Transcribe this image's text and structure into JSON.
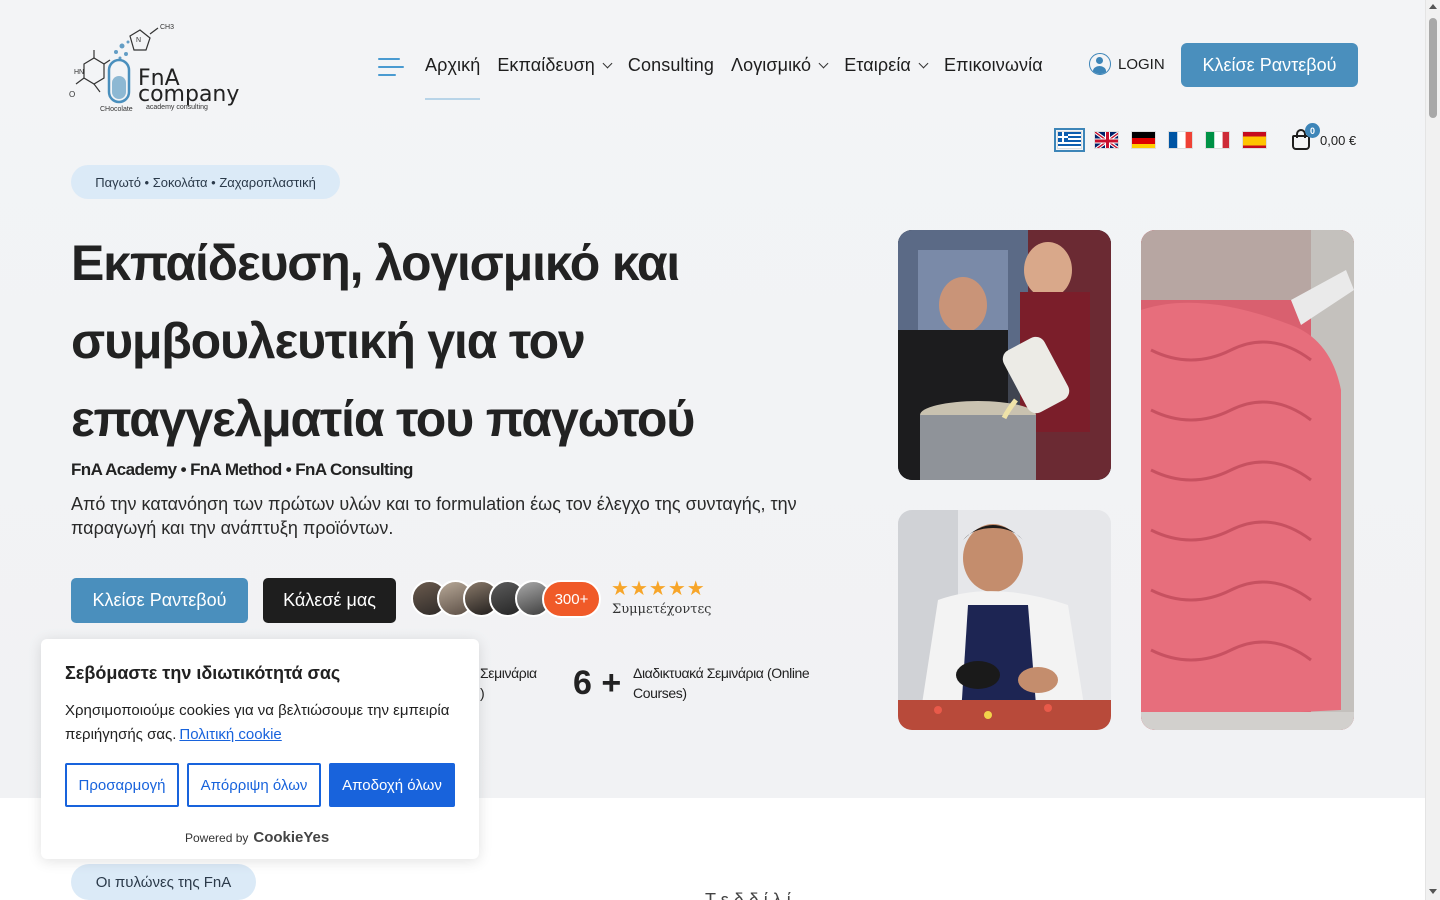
{
  "header": {
    "logo": {
      "brand": "FnA",
      "company": "company",
      "tagline": "academy consulting",
      "chem_labels": [
        "CH3",
        "HN",
        "O",
        "N",
        "CHocolate"
      ]
    },
    "nav": [
      {
        "label": "Αρχική",
        "dropdown": false,
        "active": true
      },
      {
        "label": "Εκπαίδευση",
        "dropdown": true,
        "active": false
      },
      {
        "label": "Consulting",
        "dropdown": false,
        "active": false
      },
      {
        "label": "Λογισμικό",
        "dropdown": true,
        "active": false
      },
      {
        "label": "Εταιρεία",
        "dropdown": true,
        "active": false
      },
      {
        "label": "Επικοινωνία",
        "dropdown": false,
        "active": false
      }
    ],
    "login_label": "LOGIN",
    "cta_label": "Κλείσε Ραντεβού",
    "languages": [
      "greek",
      "english",
      "german",
      "french",
      "italian",
      "spanish"
    ],
    "selected_language": "greek",
    "cart": {
      "count": "0",
      "total": "0,00 €"
    }
  },
  "hero": {
    "tag": "Παγωτό • Σοκολάτα • Ζαχαροπλαστική",
    "title_lines": [
      "Εκπαίδευση, λογισμικό και",
      "συμβουλευτική για τον",
      "επαγγελματία του παγωτού"
    ],
    "subtitle": "FnA Academy • FnA Method • FnA Consulting",
    "description": "Από την κατανόηση των πρώτων υλών και το formulation έως τον έλεγχο της συνταγής, την παραγωγή και την ανάπτυξη προϊόντων.",
    "primary_button": "Κλείσε Ραντεβού",
    "secondary_button": "Κάλεσέ μας",
    "participants": {
      "count": "300+",
      "rating": 5,
      "label": "Συμμετέχοντες"
    },
    "stats": [
      {
        "partial_label": "Σεμινάρια",
        "partial_suffix": ")"
      },
      {
        "number": "6 +",
        "label": "Διαδικτυακά Σεμινάρια (Online Courses)"
      }
    ]
  },
  "cookie_banner": {
    "title": "Σεβόμαστε την ιδιωτικότητά σας",
    "text": "Χρησιμοποιούμε cookies για να βελτιώσουμε την εμπειρία περιήγησής σας.",
    "link": "Πολιτική cookie",
    "buttons": {
      "customize": "Προσαρμογή",
      "reject": "Απόρριψη όλων",
      "accept": "Αποδοχή όλων"
    },
    "powered_by": "Powered by",
    "brand": "CookieYes"
  },
  "section": {
    "pill": "Οι πυλώνες της FnA",
    "text_partial": "Τ    ε  δ δ  ί           λ   ί"
  },
  "colors": {
    "primary": "#4a8fbd",
    "dark": "#1e1e1e",
    "accent_orange": "#f05a28",
    "star": "#f7a529",
    "cookie_blue": "#1863dc"
  }
}
